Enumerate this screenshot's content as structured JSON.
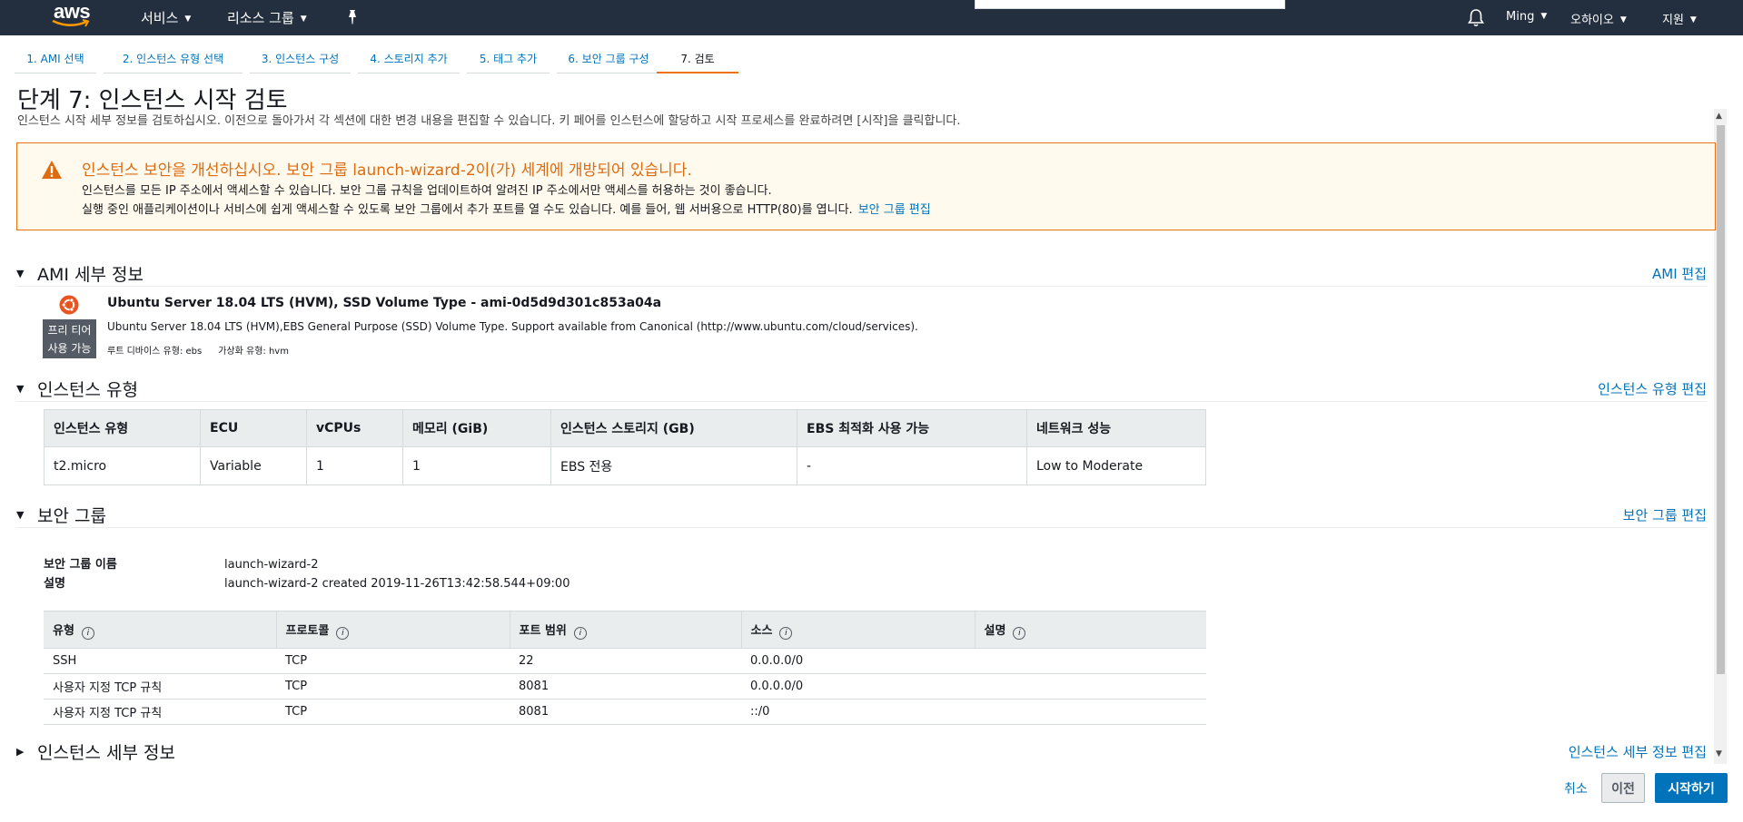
{
  "nav": {
    "logo": "aws",
    "services": "서비스",
    "resource_groups": "리소스 그룹",
    "user": "Ming",
    "region": "오하이오",
    "support": "지원"
  },
  "tabs": [
    {
      "label": "1. AMI 선택"
    },
    {
      "label": "2. 인스턴스 유형 선택"
    },
    {
      "label": "3. 인스턴스 구성"
    },
    {
      "label": "4. 스토리지 추가"
    },
    {
      "label": "5. 태그 추가"
    },
    {
      "label": "6. 보안 그룹 구성"
    },
    {
      "label": "7. 검토",
      "active": true
    }
  ],
  "page": {
    "title": "단계 7: 인스턴스 시작 검토",
    "description": "인스턴스 시작 세부 정보를 검토하십시오. 이전으로 돌아가서 각 섹션에 대한 변경 내용을 편집할 수 있습니다. 키 페어를 인스턴스에 할당하고 시작 프로세스를 완료하려면 [시작]을 클릭합니다."
  },
  "alert": {
    "title": "인스턴스 보안을 개선하십시오. 보안 그룹 launch-wizard-2이(가) 세계에 개방되어 있습니다.",
    "line1": "인스턴스를 모든 IP 주소에서 액세스할 수 있습니다. 보안 그룹 규칙을 업데이트하여 알려진 IP 주소에서만 액세스를 허용하는 것이 좋습니다.",
    "line2": "실행 중인 애플리케이션이나 서비스에 쉽게 액세스할 수 있도록 보안 그룹에서 추가 포트를 열 수도 있습니다. 예를 들어, 웹 서버용으로 HTTP(80)를 엽니다.",
    "link": "보안 그룹 편집",
    "color": "#ec7211"
  },
  "ami": {
    "section_title": "AMI 세부 정보",
    "edit": "AMI 편집",
    "name": "Ubuntu Server 18.04 LTS (HVM), SSD Volume Type - ami-0d5d9d301c853a04a",
    "description": "Ubuntu Server 18.04 LTS (HVM),EBS General Purpose (SSD) Volume Type. Support available from Canonical (http://www.ubuntu.com/cloud/services).",
    "badge_line1": "프리 티어",
    "badge_line2": "사용 가능",
    "root_device": "루트 디바이스 유형: ebs",
    "virtualization": "가상화 유형: hvm",
    "icon": "ubuntu-icon"
  },
  "instance_type": {
    "section_title": "인스턴스 유형",
    "edit": "인스턴스 유형 편집",
    "columns": [
      "인스턴스 유형",
      "ECU",
      "vCPUs",
      "메모리 (GiB)",
      "인스턴스 스토리지 (GB)",
      "EBS 최적화 사용 가능",
      "네트워크 성능"
    ],
    "row": [
      "t2.micro",
      "Variable",
      "1",
      "1",
      "EBS 전용",
      "-",
      "Low to Moderate"
    ]
  },
  "security_group": {
    "section_title": "보안 그룹",
    "edit": "보안 그룹 편집",
    "name_label": "보안 그룹 이름",
    "name_value": "launch-wizard-2",
    "desc_label": "설명",
    "desc_value": "launch-wizard-2 created 2019-11-26T13:42:58.544+09:00",
    "columns": [
      "유형",
      "프로토콜",
      "포트 범위",
      "소스",
      "설명"
    ],
    "rows": [
      [
        "SSH",
        "TCP",
        "22",
        "0.0.0.0/0",
        ""
      ],
      [
        "사용자 지정 TCP 규칙",
        "TCP",
        "8081",
        "0.0.0.0/0",
        ""
      ],
      [
        "사용자 지정 TCP 규칙",
        "TCP",
        "8081",
        "::/0",
        ""
      ]
    ]
  },
  "instance_details": {
    "section_title": "인스턴스 세부 정보",
    "edit": "인스턴스 세부 정보 편집"
  },
  "footer": {
    "cancel": "취소",
    "previous": "이전",
    "launch": "시작하기",
    "primary_color": "#0073bb"
  }
}
